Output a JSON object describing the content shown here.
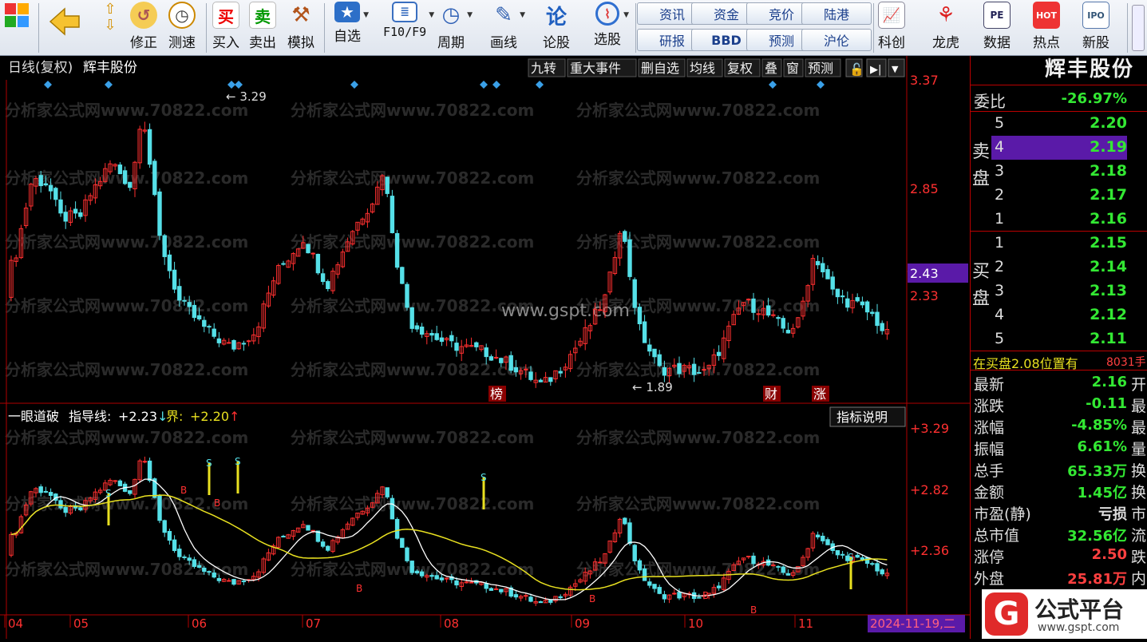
{
  "toolbar": {
    "items": [
      {
        "label": "",
        "icon": "apps-grid-icon"
      },
      {
        "label": "",
        "icon": "back-arrow-icon"
      },
      {
        "label": "修正",
        "icon": "fix-icon"
      },
      {
        "label": "测速",
        "icon": "clock-icon"
      },
      {
        "label": "买入",
        "icon": "buy-icon",
        "glyph": "买"
      },
      {
        "label": "卖出",
        "icon": "sell-icon",
        "glyph": "卖"
      },
      {
        "label": "模拟",
        "icon": "hammer-icon"
      },
      {
        "label": "自选",
        "icon": "star-folder-icon"
      },
      {
        "label": "F10/F9",
        "icon": "f10-icon"
      },
      {
        "label": "周期",
        "icon": "cycle-clock-icon"
      },
      {
        "label": "画线",
        "icon": "pencil-icon"
      },
      {
        "label": "论股",
        "icon": "discuss-icon",
        "glyph": "论"
      },
      {
        "label": "选股",
        "icon": "magnifier-chart-icon"
      },
      {
        "label": "科创",
        "icon": "chart-trend-icon"
      },
      {
        "label": "龙虎",
        "icon": "dragon-icon"
      },
      {
        "label": "数据",
        "icon": "pe-data-icon",
        "glyph": "PE"
      },
      {
        "label": "热点",
        "icon": "hot-icon",
        "glyph": "HOT"
      },
      {
        "label": "新股",
        "icon": "ipo-icon",
        "glyph": "IPO"
      }
    ],
    "quick_buttons": [
      "资讯",
      "资金",
      "竞价",
      "陆港",
      "研报",
      "BBD",
      "预测",
      "沪伦"
    ]
  },
  "main_chart": {
    "title": "日线(复权)",
    "stock_name": "辉丰股份",
    "tool_buttons": [
      "九转",
      "重大事件",
      "删自选",
      "均线",
      "复权",
      "叠",
      "窗",
      "预测"
    ],
    "y_ticks": [
      "3.37",
      "2.85",
      "2.33"
    ],
    "current_price_tag": "2.43",
    "high_label": "3.29",
    "low_label": "1.89",
    "event_markers": [
      "榜",
      "财",
      "涨"
    ],
    "watermark_text": "分析家公式网www.70822.com",
    "watermark_center": "www.gspt.com"
  },
  "indicator": {
    "name": "一眼道破",
    "guide_label": "指导线:",
    "guide_value": "+2.23",
    "bound_label": "界:",
    "bound_value": "+2.20",
    "help_button": "指标说明",
    "y_ticks": [
      "+3.29",
      "+2.82",
      "+2.36"
    ],
    "signals": [
      "S",
      "B"
    ]
  },
  "x_axis": {
    "months": [
      "04",
      "05",
      "06",
      "07",
      "08",
      "09",
      "10",
      "11"
    ],
    "cursor_date": "2024-11-19,二"
  },
  "side_panel": {
    "stock_name": "辉丰股份",
    "weibi_label": "委比",
    "weibi_value": "-26.97%",
    "sell_label": [
      "卖",
      "盘"
    ],
    "buy_label": [
      "买",
      "盘"
    ],
    "sell_orders": [
      {
        "level": "5",
        "price": "2.20"
      },
      {
        "level": "4",
        "price": "2.19"
      },
      {
        "level": "3",
        "price": "2.18"
      },
      {
        "level": "2",
        "price": "2.17"
      },
      {
        "level": "1",
        "price": "2.16"
      }
    ],
    "buy_orders": [
      {
        "level": "1",
        "price": "2.15"
      },
      {
        "level": "2",
        "price": "2.14"
      },
      {
        "level": "3",
        "price": "2.13"
      },
      {
        "level": "4",
        "price": "2.12"
      },
      {
        "level": "5",
        "price": "2.11"
      }
    ],
    "notice": "在买盘2.08位置有",
    "notice_qty": "8031手",
    "stats": [
      {
        "label": "最新",
        "value": "2.16",
        "color": "#33e833",
        "trail": "开"
      },
      {
        "label": "涨跌",
        "value": "-0.11",
        "color": "#33e833",
        "trail": "最"
      },
      {
        "label": "涨幅",
        "value": "-4.85%",
        "color": "#33e833",
        "trail": "最"
      },
      {
        "label": "振幅",
        "value": "6.61%",
        "color": "#33e833",
        "trail": "量"
      },
      {
        "label": "总手",
        "value": "65.33万",
        "color": "#33e833",
        "trail": "换"
      },
      {
        "label": "金额",
        "value": "1.45亿",
        "color": "#33e833",
        "trail": "换"
      },
      {
        "label": "市盈(静)",
        "value": "亏损",
        "color": "#dddddd",
        "trail": "市"
      },
      {
        "label": "总市值",
        "value": "32.56亿",
        "color": "#33e833",
        "trail": "流"
      },
      {
        "label": "涨停",
        "value": "2.50",
        "color": "#ff4040",
        "trail": "跌"
      },
      {
        "label": "外盘",
        "value": "25.81万",
        "color": "#ff4040",
        "trail": "内"
      }
    ]
  },
  "logo": {
    "brand": "公式平台",
    "url": "www.gspt.com"
  },
  "colors": {
    "up": "#ff3030",
    "down": "#55e0e8",
    "guide": "#ffffff",
    "bound": "#e8e020",
    "border": "#b00000"
  }
}
